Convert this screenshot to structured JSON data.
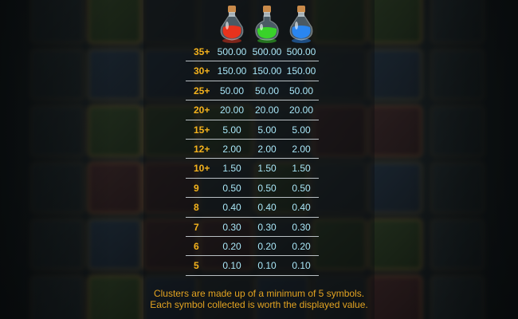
{
  "potions": [
    {
      "name": "red-potion",
      "color": "#e8331d"
    },
    {
      "name": "green-potion",
      "color": "#39d22a"
    },
    {
      "name": "blue-potion",
      "color": "#2a86f0"
    }
  ],
  "paytable": {
    "rows": [
      {
        "count": "35+",
        "values": [
          "500.00",
          "500.00",
          "500.00"
        ]
      },
      {
        "count": "30+",
        "values": [
          "150.00",
          "150.00",
          "150.00"
        ]
      },
      {
        "count": "25+",
        "values": [
          "50.00",
          "50.00",
          "50.00"
        ]
      },
      {
        "count": "20+",
        "values": [
          "20.00",
          "20.00",
          "20.00"
        ]
      },
      {
        "count": "15+",
        "values": [
          "5.00",
          "5.00",
          "5.00"
        ]
      },
      {
        "count": "12+",
        "values": [
          "2.00",
          "2.00",
          "2.00"
        ]
      },
      {
        "count": "10+",
        "values": [
          "1.50",
          "1.50",
          "1.50"
        ]
      },
      {
        "count": "9",
        "values": [
          "0.50",
          "0.50",
          "0.50"
        ]
      },
      {
        "count": "8",
        "values": [
          "0.40",
          "0.40",
          "0.40"
        ]
      },
      {
        "count": "7",
        "values": [
          "0.30",
          "0.30",
          "0.30"
        ]
      },
      {
        "count": "6",
        "values": [
          "0.20",
          "0.20",
          "0.20"
        ]
      },
      {
        "count": "5",
        "values": [
          "0.10",
          "0.10",
          "0.10"
        ]
      }
    ]
  },
  "footer": {
    "line1": "Clusters are made up of a minimum of 5 symbols.",
    "line2": "Each symbol collected is worth the displayed value."
  },
  "colors": {
    "count_text": "#f5b31c",
    "value_text": "#a9e6f7",
    "footer_text": "#e3a321",
    "divider": "#b9c0c4"
  }
}
